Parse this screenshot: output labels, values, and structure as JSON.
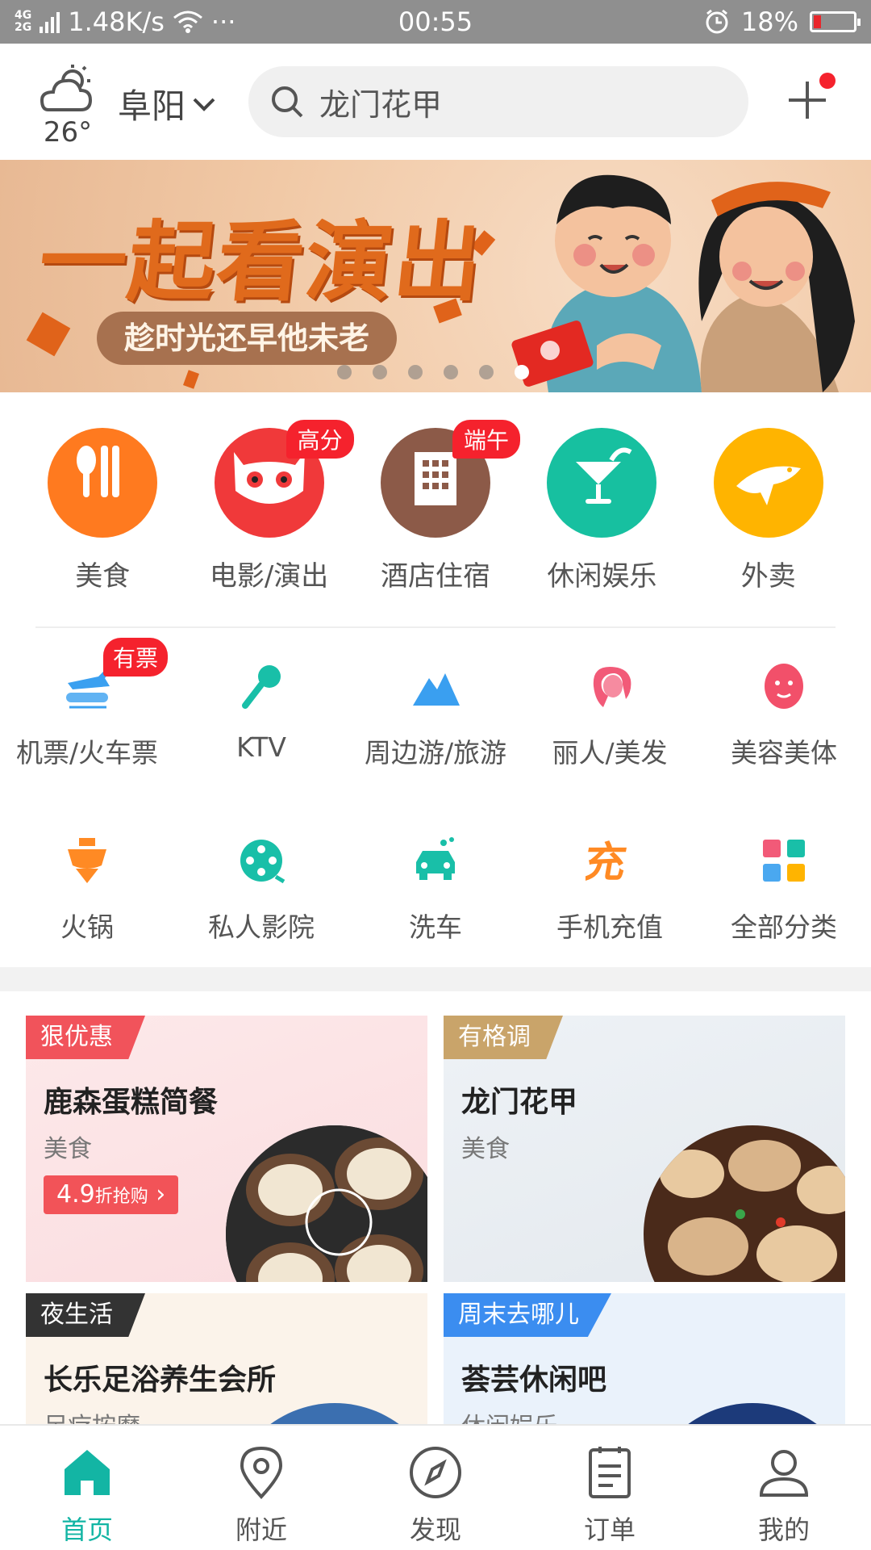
{
  "status_bar": {
    "network_top": "4G",
    "network_bottom": "2G",
    "speed": "1.48K/s",
    "more": "···",
    "time": "00:55",
    "battery": "18%",
    "battery_level": 0.18,
    "battery_color": "#e8262b"
  },
  "header": {
    "temperature": "26°",
    "city": "阜阳",
    "search_placeholder": "龙门花甲",
    "weather_icon": "partly-cloudy-icon",
    "add_icon": "plus-icon"
  },
  "banner": {
    "title": "一起看演出",
    "subtitle": "趁时光还早他未老",
    "dot_count": 6,
    "active_dot": 5
  },
  "primary_categories": [
    {
      "label": "美食",
      "icon": "fork-knife-icon",
      "color": "#ff7a1f",
      "tag": ""
    },
    {
      "label": "电影/演出",
      "icon": "cat-face-icon",
      "color": "#f0393a",
      "tag": "高分"
    },
    {
      "label": "酒店住宿",
      "icon": "hotel-building-icon",
      "color": "#8c5a48",
      "tag": "端午"
    },
    {
      "label": "休闲娱乐",
      "icon": "cocktail-glass-icon",
      "color": "#17c0a0",
      "tag": ""
    },
    {
      "label": "外卖",
      "icon": "kangaroo-icon",
      "color": "#ffb400",
      "tag": ""
    }
  ],
  "secondary_categories": [
    {
      "label": "机票/火车票",
      "icon": "plane-train-icon",
      "color": "#3aa0f0",
      "tag": "有票"
    },
    {
      "label": "KTV",
      "icon": "microphone-icon",
      "color": "#19bfa8",
      "tag": ""
    },
    {
      "label": "周边游/旅游",
      "icon": "mountain-icon",
      "color": "#3a9ff0",
      "tag": ""
    },
    {
      "label": "丽人/美发",
      "icon": "woman-hair-icon",
      "color": "#f25a78",
      "tag": ""
    },
    {
      "label": "美容美体",
      "icon": "face-mask-icon",
      "color": "#f2506a",
      "tag": ""
    },
    {
      "label": "火锅",
      "icon": "hotpot-icon",
      "color": "#ff8a24",
      "tag": ""
    },
    {
      "label": "私人影院",
      "icon": "film-reel-icon",
      "color": "#19bfa8",
      "tag": ""
    },
    {
      "label": "洗车",
      "icon": "car-wash-icon",
      "color": "#19bfa8",
      "tag": ""
    },
    {
      "label": "手机充值",
      "icon": "recharge-icon",
      "color": "#ff8a24",
      "tag": ""
    },
    {
      "label": "全部分类",
      "icon": "grid-icon",
      "color": "#4aa8f0",
      "tag": ""
    }
  ],
  "cards": [
    {
      "tag": "狠优惠",
      "tag_color": "#f1535b",
      "title": "鹿森蛋糕简餐",
      "subtitle": "美食",
      "price": "4.9",
      "price_suffix": "折抢购",
      "style": "pink"
    },
    {
      "tag": "有格调",
      "tag_color": "#c9a46a",
      "title": "龙门花甲",
      "subtitle": "美食",
      "style": "grey"
    },
    {
      "tag": "夜生活",
      "tag_color": "#333333",
      "title": "长乐足浴养生会所",
      "subtitle": "足疗按摩",
      "style": "cream"
    },
    {
      "tag": "周末去哪儿",
      "tag_color": "#3b8df0",
      "title": "荟芸休闲吧",
      "subtitle": "休闲娱乐",
      "style": "blue"
    }
  ],
  "bottom_nav": [
    {
      "label": "首页",
      "icon": "home-icon",
      "active": true
    },
    {
      "label": "附近",
      "icon": "location-pin-icon",
      "active": false
    },
    {
      "label": "发现",
      "icon": "compass-icon",
      "active": false
    },
    {
      "label": "订单",
      "icon": "order-list-icon",
      "active": false
    },
    {
      "label": "我的",
      "icon": "user-icon",
      "active": false
    }
  ],
  "accent_color": "#13b5a4"
}
